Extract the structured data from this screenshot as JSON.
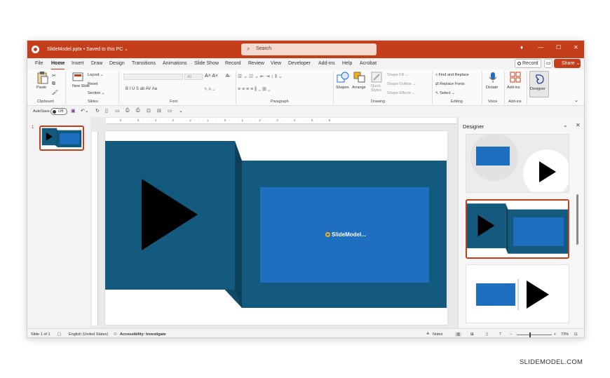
{
  "titlebar": {
    "doc_title": "SlideModel.pptx • Saved to this PC ⌄",
    "search_placeholder": "Search",
    "icons": [
      "powerpoint-logo",
      "search-icon",
      "lightbulb-icon",
      "minimize-icon",
      "maximize-icon",
      "close-icon"
    ]
  },
  "menu": {
    "items": [
      "File",
      "Home",
      "Insert",
      "Draw",
      "Design",
      "Transitions",
      "Animations",
      "Slide Show",
      "Record",
      "Review",
      "View",
      "Developer",
      "Add-ins",
      "Help",
      "Acrobat"
    ],
    "active": "Home",
    "record_label": "Record",
    "share_label": "Share ⌄"
  },
  "ribbon": {
    "clipboard": {
      "paste": "Paste",
      "label": "Clipboard"
    },
    "slides": {
      "new_slide": "New Slide",
      "layout": "Layout ⌄",
      "reset": "Reset",
      "section": "Section ⌄",
      "label": "Slides"
    },
    "font": {
      "size": "40",
      "format_buttons": "B  I  U  S  ab  AV  Aa",
      "label": "Font"
    },
    "paragraph": {
      "label": "Paragraph"
    },
    "drawing": {
      "shapes": "Shapes",
      "arrange": "Arrange",
      "quick_styles": "Quick Styles",
      "shape_fill": "Shape Fill ⌄",
      "shape_outline": "Shape Outline ⌄",
      "shape_effects": "Shape Effects ⌄",
      "label": "Drawing"
    },
    "editing": {
      "find_replace": "Find and Replace",
      "replace_fonts": "Replace Fonts",
      "select": "Select ⌄",
      "label": "Editing"
    },
    "voice": {
      "dictate": "Dictate",
      "label": "Voice"
    },
    "addins": {
      "addins": "Add-ins",
      "label": "Add-ins"
    },
    "designer": {
      "label": "Designer"
    }
  },
  "qat": {
    "autosave": "AutoSave",
    "toggle": "Off"
  },
  "thumbnails": {
    "slide_number": "1"
  },
  "ruler": {
    "ticks": "6 · · · 5 · · · 4 · · · 3 · · · 2 · · · 1 · · · 0 · · · 1 · · · 2 · · · 3 · · · 4 · · · 5 · · · 6"
  },
  "slide": {
    "logo_text": "SlideModel..."
  },
  "designer": {
    "title": "Designer"
  },
  "status": {
    "slide_count": "Slide 1 of 1",
    "language": "English (United States)",
    "accessibility": "Accessibility: Investigate",
    "notes": "Notes",
    "zoom": "73%"
  },
  "colors": {
    "accent": "#c43e1c",
    "slide_dark": "#145a7e",
    "slide_bright": "#1f6fc1"
  },
  "watermark": "SLIDEMODEL.COM"
}
